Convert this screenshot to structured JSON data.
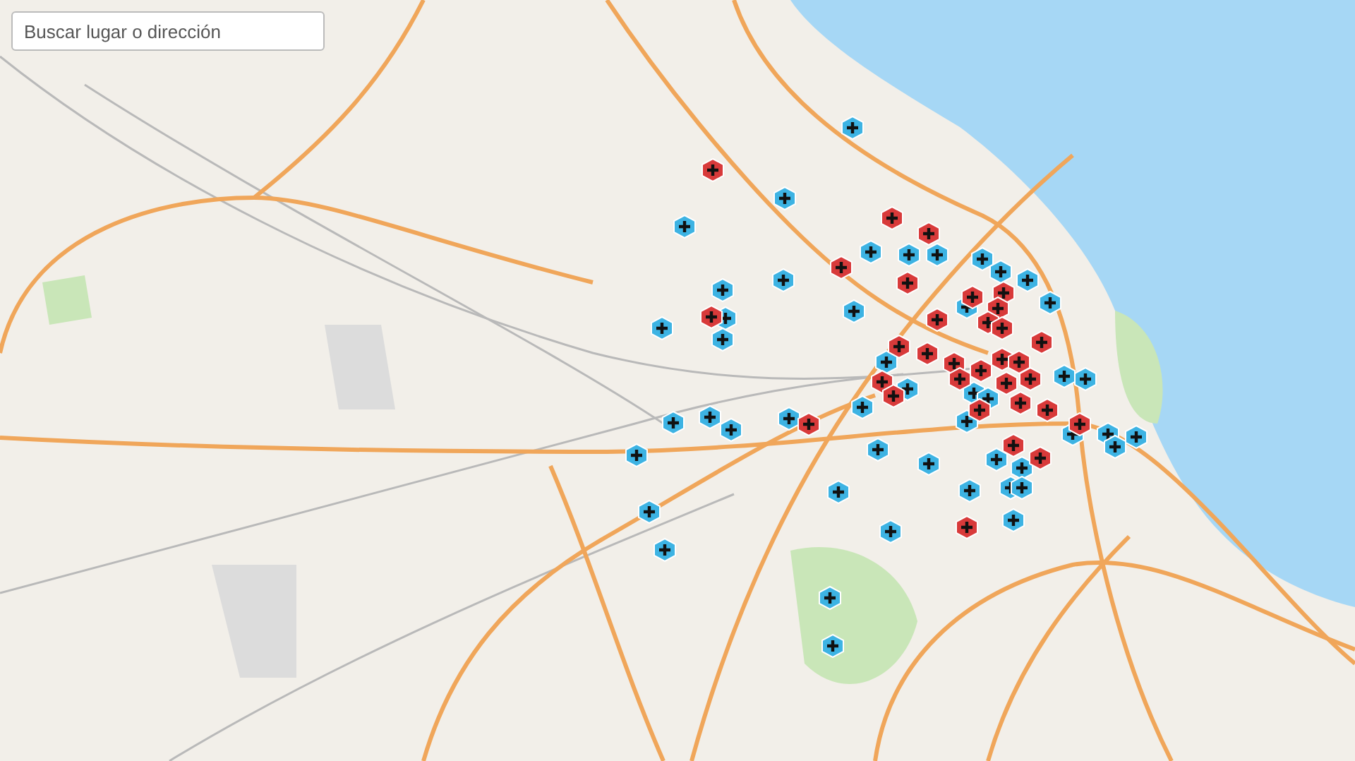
{
  "search": {
    "placeholder": "Buscar lugar o dirección"
  },
  "markers": [
    {
      "color": "#3db3e3"
    },
    {
      "color": "#3db3e3"
    },
    {
      "color": "#3db3e3"
    },
    {
      "color": "#3db3e3"
    },
    {
      "color": "#3db3e3"
    },
    {
      "color": "#3db3e3"
    },
    {
      "color": "#3db3e3"
    },
    {
      "color": "#3db3e3"
    },
    {
      "color": "#3db3e3"
    },
    {
      "color": "#3db3e3"
    },
    {
      "color": "#3db3e3"
    },
    {
      "color": "#3db3e3"
    },
    {
      "color": "#3db3e3"
    },
    {
      "color": "#3db3e3"
    },
    {
      "color": "#3db3e3"
    },
    {
      "color": "#3db3e3"
    },
    {
      "color": "#3db3e3"
    },
    {
      "color": "#3db3e3"
    },
    {
      "color": "#3db3e3"
    },
    {
      "color": "#3db3e3"
    },
    {
      "color": "#3db3e3"
    },
    {
      "color": "#3db3e3"
    },
    {
      "color": "#3db3e3"
    },
    {
      "color": "#3db3e3"
    },
    {
      "color": "#3db3e3"
    },
    {
      "color": "#3db3e3"
    },
    {
      "color": "#3db3e3"
    },
    {
      "color": "#3db3e3"
    },
    {
      "color": "#3db3e3"
    },
    {
      "color": "#3db3e3"
    },
    {
      "color": "#3db3e3"
    },
    {
      "color": "#3db3e3"
    },
    {
      "color": "#3db3e3"
    },
    {
      "color": "#3db3e3"
    },
    {
      "color": "#3db3e3"
    },
    {
      "color": "#3db3e3"
    },
    {
      "color": "#3db3e3"
    },
    {
      "color": "#3db3e3"
    },
    {
      "color": "#3db3e3"
    },
    {
      "color": "#3db3e3"
    },
    {
      "color": "#3db3e3"
    },
    {
      "color": "#3db3e3"
    },
    {
      "color": "#3db3e3"
    },
    {
      "color": "#3db3e3"
    },
    {
      "color": "#3db3e3"
    },
    {
      "color": "#3db3e3"
    },
    {
      "color": "#3db3e3"
    },
    {
      "color": "#3db3e3"
    },
    {
      "color": "#d83a3a"
    },
    {
      "color": "#d83a3a"
    },
    {
      "color": "#d83a3a"
    },
    {
      "color": "#d83a3a"
    },
    {
      "color": "#d83a3a"
    },
    {
      "color": "#d83a3a"
    },
    {
      "color": "#d83a3a"
    },
    {
      "color": "#d83a3a"
    },
    {
      "color": "#d83a3a"
    },
    {
      "color": "#d83a3a"
    },
    {
      "color": "#d83a3a"
    },
    {
      "color": "#d83a3a"
    },
    {
      "color": "#d83a3a"
    },
    {
      "color": "#d83a3a"
    },
    {
      "color": "#d83a3a"
    },
    {
      "color": "#d83a3a"
    },
    {
      "color": "#d83a3a"
    },
    {
      "color": "#d83a3a"
    },
    {
      "color": "#d83a3a"
    },
    {
      "color": "#d83a3a"
    },
    {
      "color": "#d83a3a"
    },
    {
      "color": "#d83a3a"
    },
    {
      "color": "#d83a3a"
    },
    {
      "color": "#d83a3a"
    },
    {
      "color": "#d83a3a"
    },
    {
      "color": "#d83a3a"
    },
    {
      "color": "#d83a3a"
    },
    {
      "color": "#d83a3a"
    },
    {
      "color": "#d83a3a"
    },
    {
      "color": "#d83a3a"
    },
    {
      "color": "#d83a3a"
    },
    {
      "color": "#d83a3a"
    }
  ]
}
